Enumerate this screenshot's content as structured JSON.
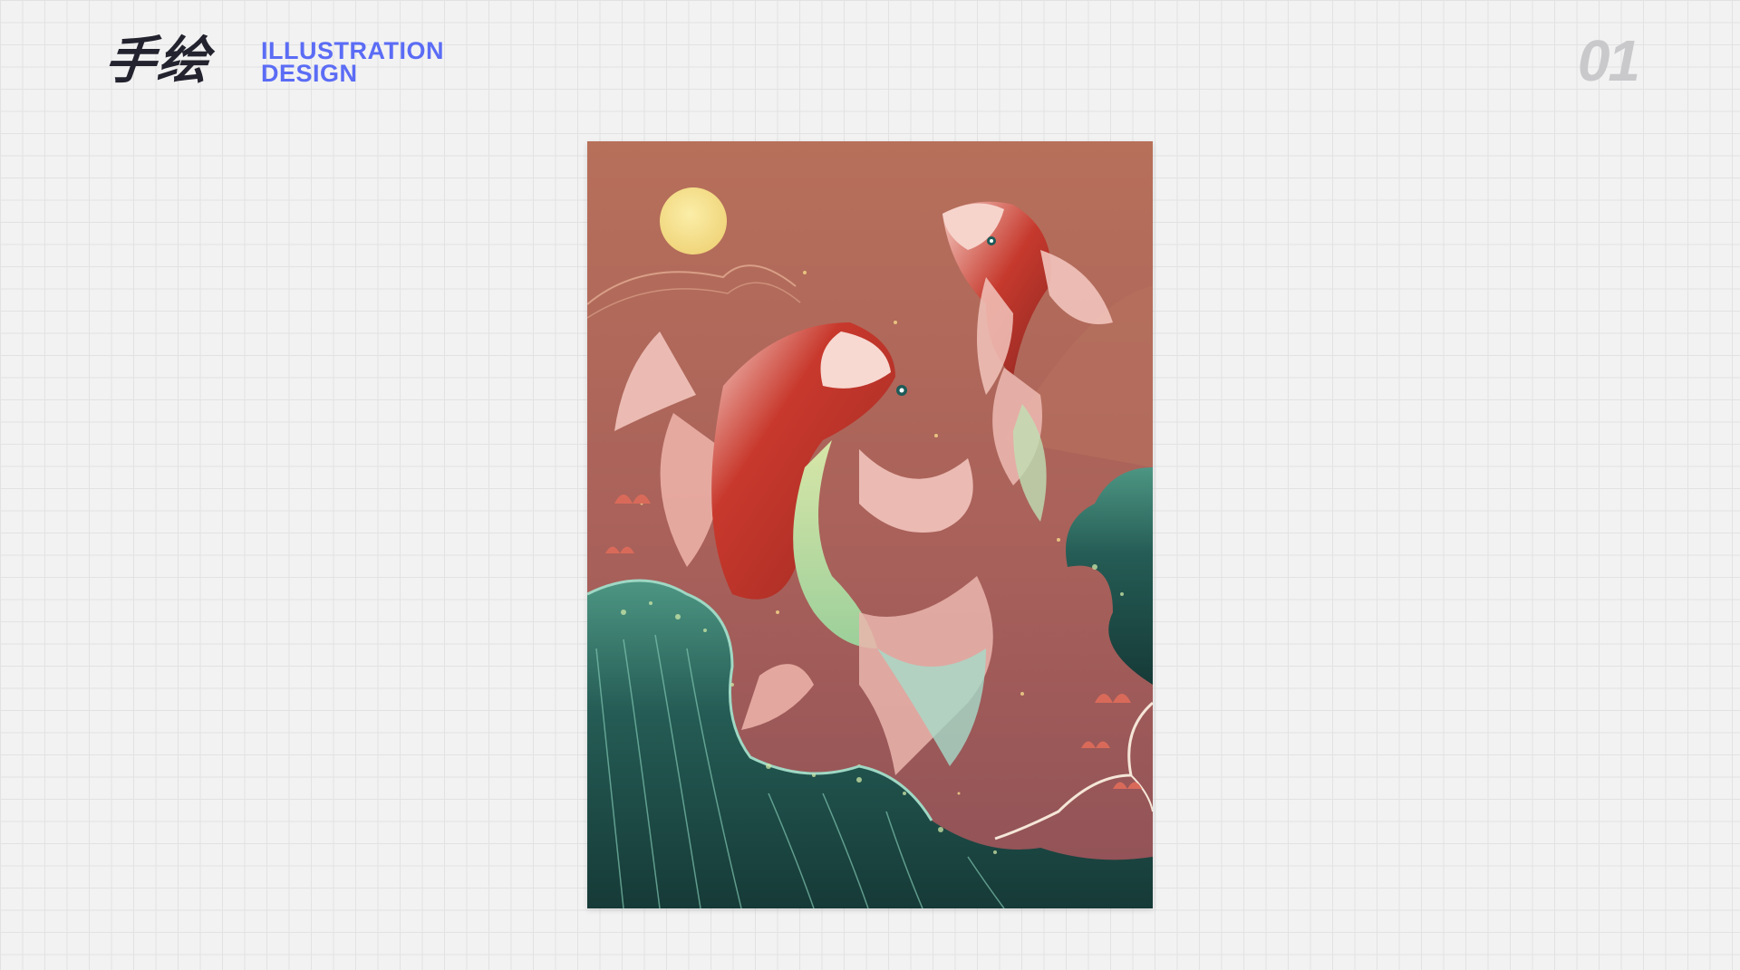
{
  "header": {
    "title": "手绘",
    "subtitle_line1": "ILLUSTRATION",
    "subtitle_line2": "DESIGN",
    "page_number": "01"
  },
  "colors": {
    "background": "#f2f2f2",
    "grid": "#e2e2e2",
    "title": "#23232f",
    "accent": "#5b6cf5",
    "page_number": "#c9c9cc",
    "art_sky_top": "#b86e58",
    "art_sky_bottom": "#9a5a5c",
    "art_moon": "#f5e08c",
    "art_koi_red": "#c43b2e",
    "art_koi_pink": "#f2c4bc",
    "art_wave_teal": "#6fbfa9",
    "art_wave_dark": "#183f3b"
  },
  "artwork": {
    "subject": "koi-fish-illustration"
  }
}
